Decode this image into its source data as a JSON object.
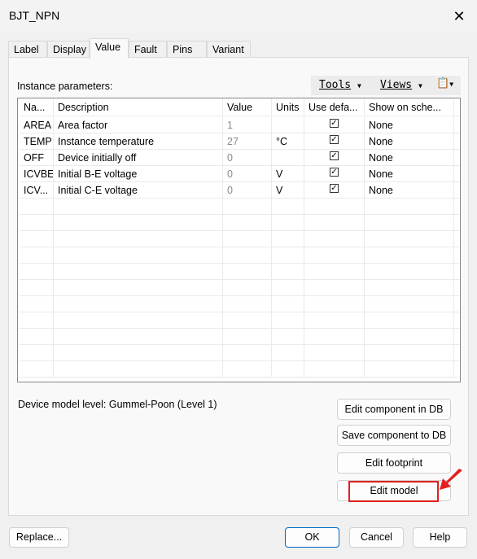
{
  "window": {
    "title": "BJT_NPN",
    "close_icon": "close-icon"
  },
  "tabs": [
    {
      "label": "Label"
    },
    {
      "label": "Display"
    },
    {
      "label": "Value",
      "active": true
    },
    {
      "label": "Fault"
    },
    {
      "label": "Pins"
    },
    {
      "label": "Variant"
    }
  ],
  "instance_label": "Instance parameters:",
  "toolbar": {
    "tools": "Tools",
    "views": "Views",
    "properties_icon": "properties-icon"
  },
  "table": {
    "columns": [
      "Na...",
      "Description",
      "Value",
      "Units",
      "Use defa...",
      "Show on sche..."
    ],
    "rows": [
      {
        "name": "AREA",
        "description": "Area factor",
        "value": "1",
        "units": "",
        "use_default": true,
        "show": "None"
      },
      {
        "name": "TEMP",
        "description": "Instance temperature",
        "value": "27",
        "units": "°C",
        "use_default": true,
        "show": "None"
      },
      {
        "name": "OFF",
        "description": "Device initially off",
        "value": "0",
        "units": "",
        "use_default": true,
        "show": "None"
      },
      {
        "name": "ICVBE",
        "description": "Initial B-E voltage",
        "value": "0",
        "units": "V",
        "use_default": true,
        "show": "None"
      },
      {
        "name": "ICV...",
        "description": "Initial C-E voltage",
        "value": "0",
        "units": "V",
        "use_default": true,
        "show": "None"
      }
    ]
  },
  "model_level": "Device model level: Gummel-Poon (Level 1)",
  "buttons": {
    "edit_component": "Edit component in DB",
    "save_component": "Save component to DB",
    "edit_footprint": "Edit footprint",
    "edit_model": "Edit model",
    "replace": "Replace...",
    "ok": "OK",
    "cancel": "Cancel",
    "help": "Help"
  },
  "annotation": {
    "color": "#e02020"
  }
}
